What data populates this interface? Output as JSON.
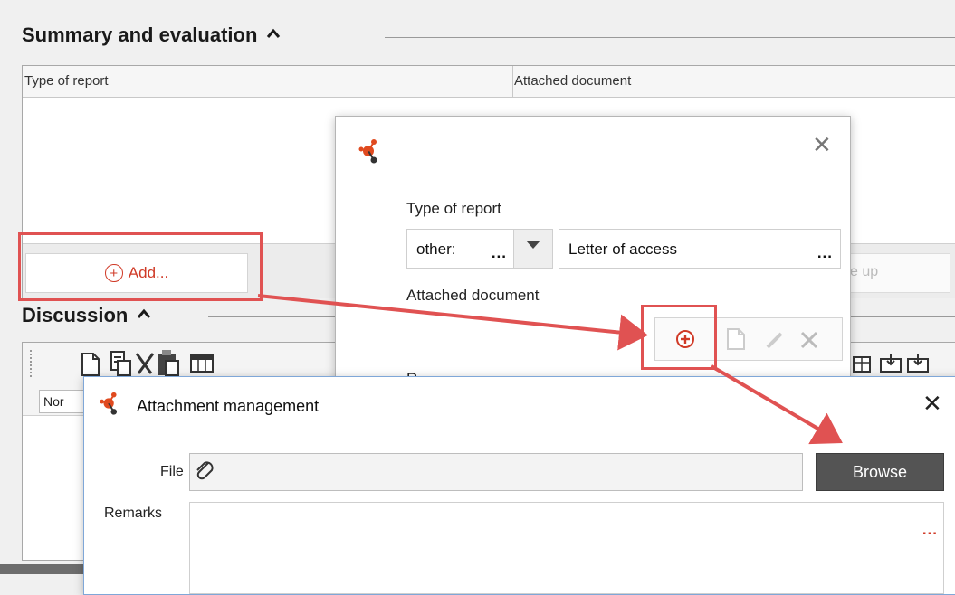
{
  "summary": {
    "title": "Summary and evaluation",
    "col_type": "Type of report",
    "col_attached": "Attached document",
    "add_label": "Add...",
    "ghost_right": "e up"
  },
  "discussion": {
    "title": "Discussion",
    "style_select": "Nor"
  },
  "report_dialog": {
    "type_label": "Type of report",
    "type_value": "other:",
    "type_dots": "...",
    "report_value": "Letter of access",
    "report_dots": "...",
    "attached_label": "Attached document",
    "remarks_label_partial": "R"
  },
  "attachment_dialog": {
    "title": "Attachment management",
    "file_label": "File",
    "browse_label": "Browse",
    "remarks_label": "Remarks",
    "remarks_dots": "..."
  },
  "colors": {
    "accent_red": "#d03a27",
    "annotation_red": "#e05252",
    "browse_bg": "#545454"
  }
}
